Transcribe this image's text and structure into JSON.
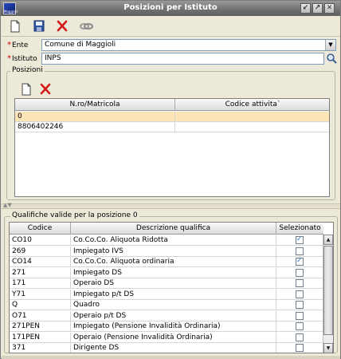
{
  "window": {
    "title": "Posizioni per Istituto",
    "app_icon_text": "Maggioli"
  },
  "toolbar": {
    "buttons": [
      "new-document-icon",
      "save-icon",
      "delete-icon",
      "link-icon"
    ]
  },
  "form": {
    "ente": {
      "required_mark": "*",
      "label": "Ente",
      "value": "Comune di Maggioli"
    },
    "istituto": {
      "required_mark": "*",
      "label": "Istituto",
      "value": "INPS"
    }
  },
  "posizioni": {
    "legend": "Posizioni",
    "columns": [
      "N.ro/Matricola",
      "Codice attivita`"
    ],
    "rows": [
      {
        "matricola": "0",
        "codice": ""
      },
      {
        "matricola": "8806402246",
        "codice": ""
      }
    ]
  },
  "qualifiche": {
    "legend": "Qualifiche valide per la posizione  0",
    "columns": [
      "Codice",
      "Descrizione qualifica",
      "Selezionato"
    ],
    "rows": [
      {
        "codice": "CO10",
        "descrizione": "Co.Co.Co. Aliquota Ridotta",
        "selezionato": true
      },
      {
        "codice": "269",
        "descrizione": "Impiegato IVS",
        "selezionato": false
      },
      {
        "codice": "CO14",
        "descrizione": "Co.Co.Co. Aliquota ordinaria",
        "selezionato": true
      },
      {
        "codice": "271",
        "descrizione": "Impiegato DS",
        "selezionato": false
      },
      {
        "codice": "171",
        "descrizione": "Operaio DS",
        "selezionato": false
      },
      {
        "codice": "Y71",
        "descrizione": "Impiegato p/t DS",
        "selezionato": false
      },
      {
        "codice": "Q",
        "descrizione": "Quadro",
        "selezionato": false
      },
      {
        "codice": "O71",
        "descrizione": "Operaio p/t DS",
        "selezionato": false
      },
      {
        "codice": "271PEN",
        "descrizione": "Impiegato (Pensione Invalidità Ordinaria)",
        "selezionato": false
      },
      {
        "codice": "171PEN",
        "descrizione": "Operaio (Pensione Invalidità Ordinaria)",
        "selezionato": false
      },
      {
        "codice": "371",
        "descrizione": "Dirigente DS",
        "selezionato": false
      }
    ]
  },
  "colors": {
    "selected_row": "#fbe5b6",
    "title_bar": "#727272",
    "check": "#3a78c8"
  }
}
